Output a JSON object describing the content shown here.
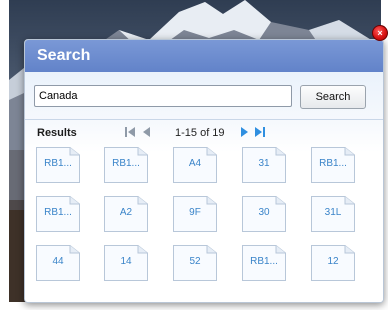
{
  "dialog": {
    "title": "Search",
    "close_glyph": "×"
  },
  "search": {
    "value": "Canada",
    "button_label": "Search"
  },
  "results": {
    "label": "Results",
    "page_count": "1-15 of 19",
    "tiles": [
      "RB1...",
      "RB1...",
      "A4",
      "31",
      "RB1...",
      "RB1...",
      "A2",
      "9F",
      "30",
      "31L",
      "44",
      "14",
      "52",
      "RB1...",
      "12"
    ]
  },
  "colors": {
    "header": "#6e8fd2",
    "pager_disabled": "#8f9aa8",
    "pager_enabled": "#2f8fe0",
    "tile_text": "#3a84c9",
    "close": "#d81414"
  },
  "icons": {
    "first_page": "first-page-icon",
    "prev_page": "prev-page-icon",
    "next_page": "next-page-icon",
    "last_page": "last-page-icon",
    "close": "close-icon",
    "tile": "document-icon"
  }
}
